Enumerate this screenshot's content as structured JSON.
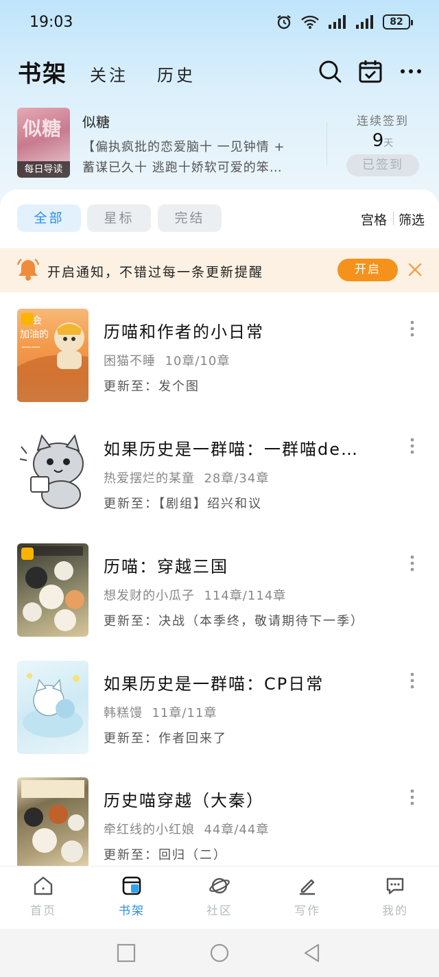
{
  "status_bar": {
    "time": "19:03",
    "battery": "82"
  },
  "header": {
    "tabs": [
      {
        "label": "书架"
      },
      {
        "label": "关注"
      },
      {
        "label": "历史"
      }
    ],
    "icons": [
      "search-icon",
      "calendar-check-icon",
      "more-icon"
    ]
  },
  "reading": {
    "cover_text": "似糖",
    "cover_tag": "每日导读",
    "title": "似糖",
    "description": "【偏执疯批的恋爱脑十 一见钟情 + 蓄谋已久十 逃跑十娇软可爱的笨…",
    "sign_label": "连续签到",
    "sign_days": "9",
    "sign_unit": "天",
    "sign_button": "已签到"
  },
  "filters": {
    "chips": [
      "全部",
      "星标",
      "完结"
    ],
    "active": "全部",
    "view_grid": "宫格",
    "view_filter": "筛选"
  },
  "notice": {
    "text": "开启通知，不错过每一条更新提醒",
    "button": "开启"
  },
  "books": [
    {
      "title": "历喵和作者的小日常",
      "author": "困猫不睡",
      "chapters": "10章/10章",
      "update": "更新至：发个图",
      "starred": true,
      "cover_text": "我会加油的——"
    },
    {
      "title": "如果历史是一群喵：一群喵de…",
      "author": "热爱摆烂的某童",
      "chapters": "28章/34章",
      "update": "更新至：【剧组】绍兴和议",
      "starred": false
    },
    {
      "title": "历喵：穿越三国",
      "author": "想发财的小瓜子",
      "chapters": "114章/114章",
      "update": "更新至：决战（本季终，敬请期待下一季）",
      "starred": true
    },
    {
      "title": "如果历史是一群喵：CP日常",
      "author": "韩糕馒",
      "chapters": "11章/11章",
      "update": "更新至：作者回来了",
      "starred": false
    },
    {
      "title": "历史喵穿越（大秦）",
      "author": "牵红线的小红娘",
      "chapters": "44章/44章",
      "update": "更新至：回归（二）",
      "starred": false
    }
  ],
  "bottom_nav": [
    {
      "label": "首页",
      "icon": "home-icon"
    },
    {
      "label": "书架",
      "icon": "bookshelf-icon"
    },
    {
      "label": "社区",
      "icon": "planet-icon"
    },
    {
      "label": "写作",
      "icon": "pen-icon"
    },
    {
      "label": "我的",
      "icon": "chat-bubble-icon"
    }
  ],
  "colors": {
    "accent": "#2a8fe6",
    "notice_bg": "#fdf1e3",
    "notice_button": "#f5921c"
  }
}
